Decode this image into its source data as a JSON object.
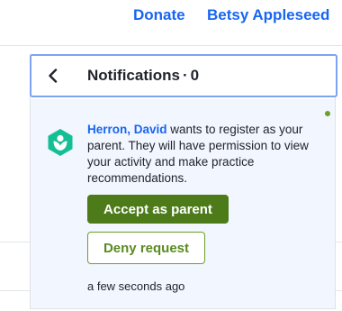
{
  "topnav": {
    "donate_label": "Donate",
    "user_name": "Betsy Appleseed"
  },
  "notifications": {
    "title": "Notifications",
    "separator": "·",
    "count": "0",
    "items": [
      {
        "requester_name": "Herron, David",
        "message_text": " wants to register as your parent. They will have permission to view your activity and make practice recommendations.",
        "accept_label": "Accept as parent",
        "deny_label": "Deny request",
        "timestamp": "a few seconds ago",
        "unread": true,
        "icon": "khan-academy-logo-icon"
      }
    ]
  },
  "colors": {
    "link_blue": "#1865f2",
    "accept_green": "#4d7b1a",
    "deny_green": "#6ca02c",
    "logo_green": "#14bf96",
    "header_focus_border": "#7ba4f4",
    "card_background": "#f2f6fe"
  }
}
